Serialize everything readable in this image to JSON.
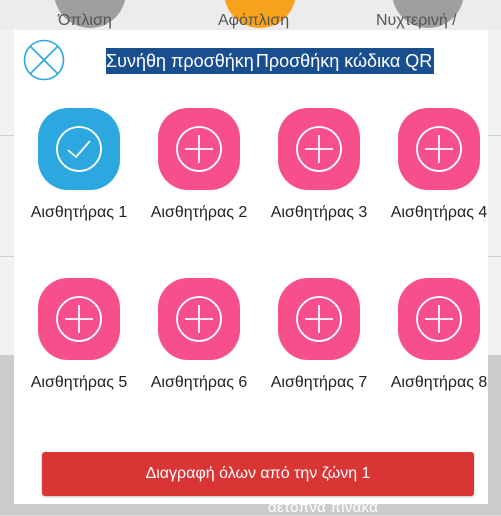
{
  "background": {
    "top_labels": [
      "Όπλιση",
      "Αφόπλιση",
      "Νυχτερινή /"
    ],
    "bottom_text": "αετόπνα πίνακα"
  },
  "dialog": {
    "close_icon": "close-icon",
    "tabs": [
      {
        "label": "Συνήθη προσθήκη"
      },
      {
        "label": "Προσθήκη κώδικα QR"
      }
    ],
    "sensors": [
      {
        "label": "Αισθητήρας 1",
        "state": "selected",
        "icon": "check-icon",
        "color": "#2ca7e0"
      },
      {
        "label": "Αισθητήρας 2",
        "state": "empty",
        "icon": "plus-icon",
        "color": "#f74f8b"
      },
      {
        "label": "Αισθητήρας 3",
        "state": "empty",
        "icon": "plus-icon",
        "color": "#f74f8b"
      },
      {
        "label": "Αισθητήρας 4",
        "state": "empty",
        "icon": "plus-icon",
        "color": "#f74f8b"
      },
      {
        "label": "Αισθητήρας 5",
        "state": "empty",
        "icon": "plus-icon",
        "color": "#f74f8b"
      },
      {
        "label": "Αισθητήρας 6",
        "state": "empty",
        "icon": "plus-icon",
        "color": "#f74f8b"
      },
      {
        "label": "Αισθητήρας 7",
        "state": "empty",
        "icon": "plus-icon",
        "color": "#f74f8b"
      },
      {
        "label": "Αισθητήρας 8",
        "state": "empty",
        "icon": "plus-icon",
        "color": "#f74f8b"
      }
    ],
    "delete_button": "Διαγραφή όλων από την ζώνη 1",
    "colors": {
      "tab_bg": "#1a4f8f",
      "accent_blue": "#2ca7e0",
      "accent_pink": "#f74f8b",
      "delete_red": "#d93535"
    }
  }
}
